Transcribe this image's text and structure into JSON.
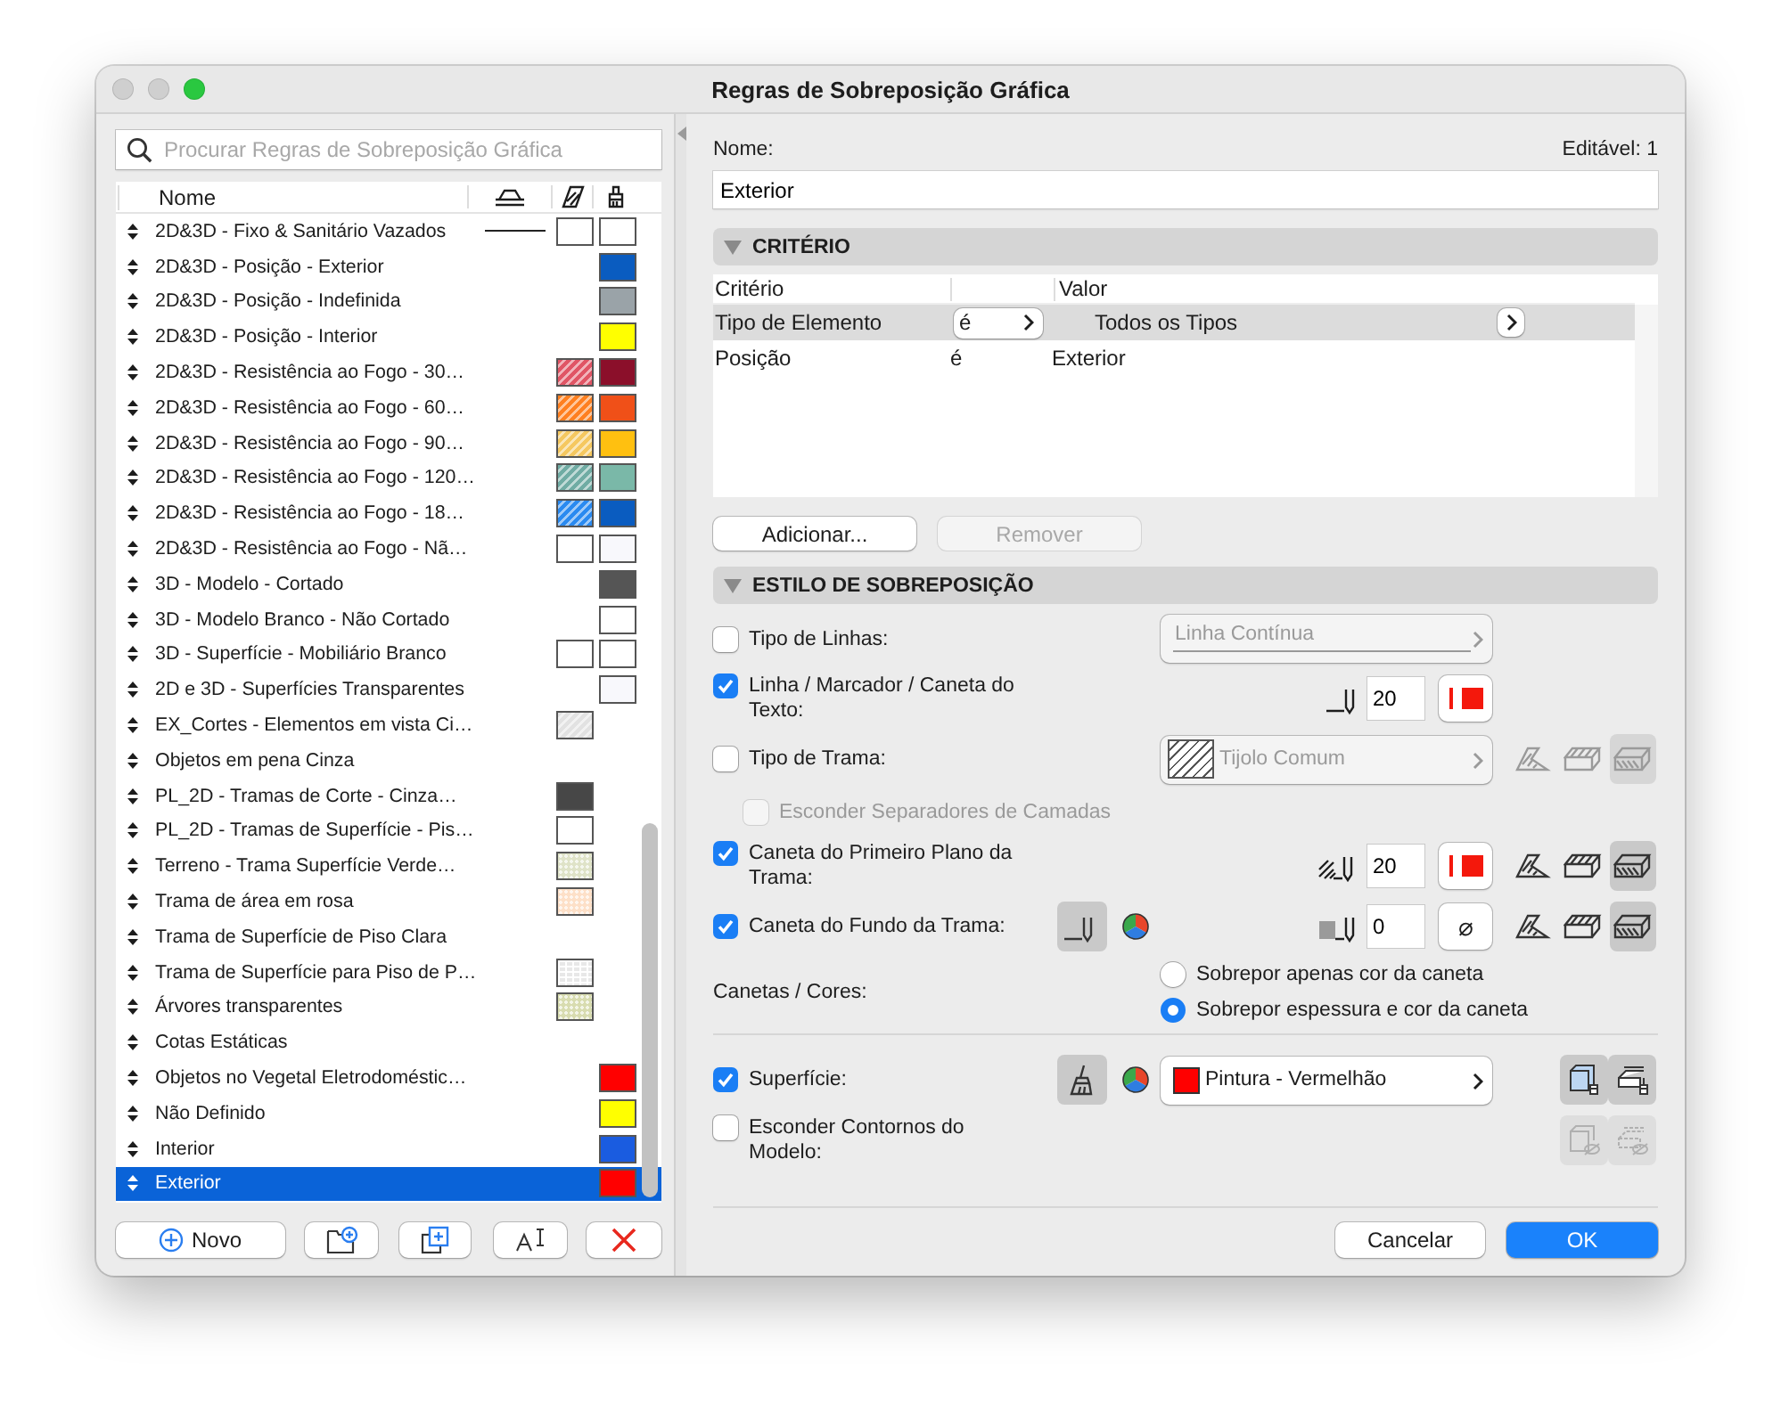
{
  "window": {
    "title": "Regras de Sobreposição Gráfica"
  },
  "search": {
    "placeholder": "Procurar Regras de Sobreposição Gráfica"
  },
  "rule_list": {
    "column_name": "Nome"
  },
  "rules": [
    {
      "name": "2D&3D - Fixo & Sanitário Vazados",
      "selected": false,
      "line": true,
      "fill": {
        "color": "#ffffff",
        "kind": "solid"
      },
      "surface": {
        "color": "#ffffff"
      }
    },
    {
      "name": "2D&3D - Posição - Exterior",
      "selected": false,
      "line": false,
      "surface": {
        "color": "#0a5cc0"
      }
    },
    {
      "name": "2D&3D - Posição - Indefinida",
      "selected": false,
      "line": false,
      "surface": {
        "color": "#9aa3a8"
      }
    },
    {
      "name": "2D&3D - Posição - Interior",
      "selected": false,
      "line": false,
      "surface": {
        "color": "#ffff00"
      }
    },
    {
      "name": "2D&3D - Resistência ao Fogo -  30…",
      "selected": false,
      "line": false,
      "fill": {
        "color": "#e05565",
        "kind": "hatch"
      },
      "surface": {
        "color": "#8b0f2a"
      }
    },
    {
      "name": "2D&3D - Resistência ao Fogo -  60…",
      "selected": false,
      "line": false,
      "fill": {
        "color": "#ff8020",
        "kind": "hatch"
      },
      "surface": {
        "color": "#f05018"
      }
    },
    {
      "name": "2D&3D - Resistência ao Fogo -  90…",
      "selected": false,
      "line": false,
      "fill": {
        "color": "#f5c860",
        "kind": "hatch"
      },
      "surface": {
        "color": "#ffc010"
      }
    },
    {
      "name": "2D&3D - Resistência ao Fogo - 120…",
      "selected": false,
      "line": false,
      "fill": {
        "color": "#70aca4",
        "kind": "hatch"
      },
      "surface": {
        "color": "#7ab8a8"
      }
    },
    {
      "name": "2D&3D - Resistência ao Fogo - 18…",
      "selected": false,
      "line": false,
      "fill": {
        "color": "#2a8af0",
        "kind": "hatch"
      },
      "surface": {
        "color": "#0a5cc0"
      }
    },
    {
      "name": "2D&3D - Resistência ao Fogo - Nã…",
      "selected": false,
      "line": false,
      "fill": {
        "color": "#ffffff",
        "kind": "solid"
      },
      "surface": {
        "color": "#f8f8fc"
      }
    },
    {
      "name": "3D - Modelo - Cortado",
      "selected": false,
      "line": false,
      "surface": {
        "color": "#555555"
      }
    },
    {
      "name": "3D - Modelo Branco - Não Cortado",
      "selected": false,
      "line": false,
      "surface": {
        "color": "#ffffff"
      }
    },
    {
      "name": "3D - Superfície - Mobiliário Branco",
      "selected": false,
      "line": false,
      "fill": {
        "color": "#ffffff",
        "kind": "solid"
      },
      "surface": {
        "color": "#ffffff"
      }
    },
    {
      "name": "2D e 3D - Superfícies Transparentes",
      "selected": false,
      "line": false,
      "surface": {
        "color": "#f8f8fc"
      }
    },
    {
      "name": "EX_Cortes - Elementos em vista Ci…",
      "selected": false,
      "line": false,
      "fill": {
        "color": "#e2e2e2",
        "kind": "hatch"
      }
    },
    {
      "name": "Objetos em pena Cinza",
      "selected": false,
      "line": false
    },
    {
      "name": "PL_2D - Tramas de Corte - Cinza…",
      "selected": false,
      "line": false,
      "fill": {
        "color": "#474747",
        "kind": "solid"
      }
    },
    {
      "name": "PL_2D - Tramas de Superfície - Pis…",
      "selected": false,
      "line": false,
      "fill": {
        "color": "#ffffff",
        "kind": "solid"
      }
    },
    {
      "name": "Terreno - Trama Superfície Verde…",
      "selected": false,
      "line": false,
      "fill": {
        "color": "#dfe3c8",
        "kind": "dots"
      }
    },
    {
      "name": "Trama de  área em rosa",
      "selected": false,
      "line": false,
      "fill": {
        "color": "#fde0c8",
        "kind": "dots"
      }
    },
    {
      "name": "Trama de Superfície de Piso Clara",
      "selected": false,
      "line": false
    },
    {
      "name": "Trama de Superfície para Piso de P…",
      "selected": false,
      "line": false,
      "fill": {
        "color": "#e8e8e8",
        "kind": "grid"
      }
    },
    {
      "name": "Árvores transparentes",
      "selected": false,
      "line": false,
      "fill": {
        "color": "#d8dcb0",
        "kind": "dots"
      }
    },
    {
      "name": "Cotas Estáticas",
      "selected": false,
      "line": false
    },
    {
      "name": "Objetos no Vegetal Eletrodoméstic…",
      "selected": false,
      "line": false,
      "surface": {
        "color": "#ff0000"
      }
    },
    {
      "name": "Não Definido",
      "selected": false,
      "line": false,
      "surface": {
        "color": "#ffff00"
      }
    },
    {
      "name": "Interior",
      "selected": false,
      "line": false,
      "surface": {
        "color": "#1a5ce0"
      }
    },
    {
      "name": "Exterior",
      "selected": true,
      "line": false,
      "surface": {
        "color": "#ff0000"
      }
    }
  ],
  "list_buttons": [
    {
      "kind": "add",
      "label": "Novo"
    },
    {
      "kind": "new-folder"
    },
    {
      "kind": "duplicate"
    },
    {
      "kind": "rename"
    },
    {
      "kind": "delete"
    }
  ],
  "name_field": {
    "label": "Nome:",
    "value": "Exterior"
  },
  "editable": "Editável: 1",
  "criteria": {
    "title": "CRITÉRIO",
    "expanded": true,
    "columns": [
      "Critério",
      "Valor"
    ],
    "rows": [
      {
        "criterion": "Tipo de Elemento",
        "operator": "é",
        "value": "Todos os Tipos",
        "selected": true
      },
      {
        "criterion": "Posição",
        "operator": "é",
        "value": "Exterior",
        "selected": false
      }
    ],
    "buttons": [
      {
        "label": "Adicionar...",
        "disabled": false
      },
      {
        "label": "Remover",
        "disabled": true
      }
    ]
  },
  "style": {
    "title": "ESTILO DE SOBREPOSIÇÃO",
    "expanded": true,
    "options": [
      {
        "kind": "line-type",
        "label": "Tipo de Linhas:",
        "checked": false,
        "dropdown": "Linha Contínua"
      },
      {
        "kind": "pen",
        "label": "Linha / Marcador / Caneta do Texto:",
        "checked": true,
        "pen": "20"
      },
      {
        "kind": "fill-type",
        "label": "Tipo de Trama:",
        "checked": false,
        "dropdown": "Tijolo Comum",
        "targets": [
          {
            "selected": false
          },
          {
            "selected": false
          },
          {
            "selected": true
          }
        ]
      },
      {
        "kind": "sub-option",
        "label": "Esconder Separadores de Camadas",
        "checked": false,
        "disabled": true
      },
      {
        "kind": "fill-pen",
        "label": "Caneta do Primeiro Plano da Trama:",
        "checked": true,
        "pen": "20",
        "targets": [
          {
            "selected": false
          },
          {
            "selected": false
          },
          {
            "selected": true
          }
        ]
      },
      {
        "kind": "background-pen",
        "label": "Caneta do Fundo da Trama:",
        "checked": true,
        "pen": "0",
        "color_button": "⌀",
        "targets": [
          {
            "selected": false
          },
          {
            "selected": false
          },
          {
            "selected": true
          }
        ]
      },
      {
        "kind": "radio-group",
        "label": "Canetas / Cores:",
        "choices": [
          {
            "label": "Sobrepor apenas cor da caneta",
            "selected": false
          },
          {
            "label": "Sobrepor espessura e cor da caneta",
            "selected": true
          }
        ]
      },
      {
        "kind": "surface",
        "label": "Superfície:",
        "checked": true,
        "dropdown": "Pintura - Vermelhão",
        "color": "#ff0000"
      },
      {
        "kind": "hide-contours",
        "label": "Esconder Contornos do Modelo:",
        "checked": false
      }
    ]
  },
  "dialog_buttons": [
    {
      "label": "Cancelar",
      "default": false
    },
    {
      "label": "OK",
      "default": true
    }
  ]
}
